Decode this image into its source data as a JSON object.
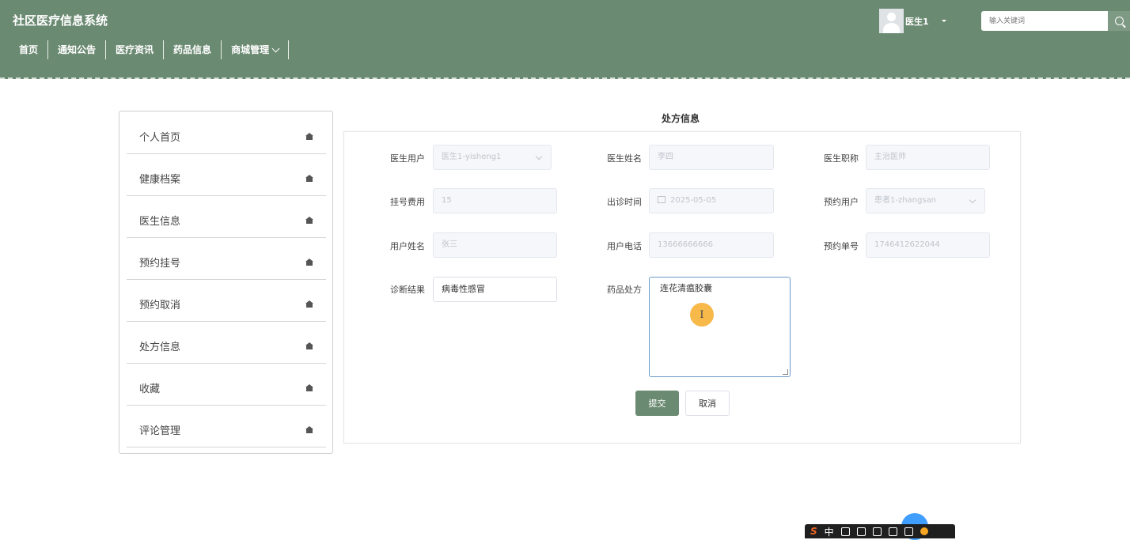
{
  "app": {
    "title": "社区医疗信息系统"
  },
  "nav": [
    {
      "label": "首页"
    },
    {
      "label": "通知公告"
    },
    {
      "label": "医疗资讯"
    },
    {
      "label": "药品信息"
    },
    {
      "label": "商城管理"
    }
  ],
  "user": {
    "name": "医生1"
  },
  "search": {
    "placeholder": "输入关键词"
  },
  "sidebar": [
    {
      "label": "个人首页"
    },
    {
      "label": "健康档案"
    },
    {
      "label": "医生信息"
    },
    {
      "label": "预约挂号"
    },
    {
      "label": "预约取消"
    },
    {
      "label": "处方信息"
    },
    {
      "label": "收藏"
    },
    {
      "label": "评论管理"
    }
  ],
  "form": {
    "title": "处方信息",
    "doctor_user": {
      "label": "医生用户",
      "value": "医生1-yisheng1"
    },
    "doctor_name": {
      "label": "医生姓名",
      "value": "李四"
    },
    "doctor_title": {
      "label": "医生职称",
      "value": "主治医师"
    },
    "reg_fee": {
      "label": "挂号费用",
      "value": "15"
    },
    "visit_time": {
      "label": "出诊时间",
      "value": "2025-05-05"
    },
    "appt_user": {
      "label": "预约用户",
      "value": "患者1-zhangsan"
    },
    "user_name": {
      "label": "用户姓名",
      "value": "张三"
    },
    "user_phone": {
      "label": "用户电话",
      "value": "13666666666"
    },
    "appt_no": {
      "label": "预约单号",
      "value": "1746412622044"
    },
    "diagnosis": {
      "label": "诊断结果",
      "value": "病毒性感冒"
    },
    "prescription": {
      "label": "药品处方",
      "value": "连花清瘟胶囊"
    },
    "submit_label": "提交",
    "cancel_label": "取消"
  },
  "ime": {
    "logo": "S",
    "mode": "中"
  },
  "colors": {
    "header": "#6b8a72",
    "accent": "#6b8a72",
    "focus_border": "#6b9ac7"
  }
}
